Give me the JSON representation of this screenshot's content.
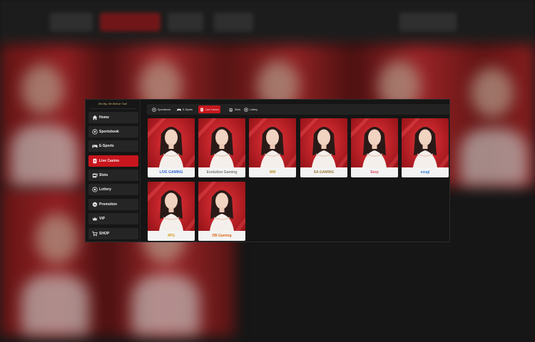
{
  "sidebar": {
    "logo_text": "Win Big. We Believe That!",
    "items": [
      {
        "label": "Home",
        "icon": "home-icon"
      },
      {
        "label": "Sportsbook",
        "icon": "soccer-ball-icon"
      },
      {
        "label": "E-Sports",
        "icon": "gamepad-icon"
      },
      {
        "label": "Live Casino",
        "icon": "playing-card-icon",
        "active": true
      },
      {
        "label": "Slots",
        "icon": "slot-machine-icon"
      },
      {
        "label": "Lottery",
        "icon": "lottery-ball-icon"
      },
      {
        "label": "Promotion",
        "icon": "gift-icon"
      },
      {
        "label": "VIP",
        "icon": "crown-icon"
      },
      {
        "label": "SHOP",
        "icon": "cart-icon"
      }
    ]
  },
  "tabs": [
    {
      "label": "Sportsbook",
      "icon": "soccer-ball-icon"
    },
    {
      "label": "E-Sports",
      "icon": "gamepad-icon"
    },
    {
      "label": "Live Casino",
      "icon": "playing-card-icon",
      "active": true
    },
    {
      "label": "Slots",
      "icon": "slot-machine-icon"
    },
    {
      "label": "Lottery",
      "icon": "lottery-ball-icon"
    }
  ],
  "games": [
    {
      "provider": "LIVE GAMING",
      "brand_color": "#3a6ad8"
    },
    {
      "provider": "Evolution Gaming",
      "brand_color": "#777777"
    },
    {
      "provider": "WM",
      "brand_color": "#b8952c"
    },
    {
      "provider": "SA GAMING",
      "brand_color": "#9a7b3a"
    },
    {
      "provider": "Sexy",
      "brand_color": "#d8435a"
    },
    {
      "provider": "ezugi",
      "brand_color": "#2f7fd0"
    },
    {
      "provider": "XPG",
      "brand_color": "#d89a1a"
    },
    {
      "provider": "DB Gaming",
      "brand_color": "#e06a1a"
    }
  ],
  "colors": {
    "accent": "#c8161d",
    "panel_bg": "#151515",
    "item_bg": "#252525",
    "card_bg": "#c41d22"
  }
}
